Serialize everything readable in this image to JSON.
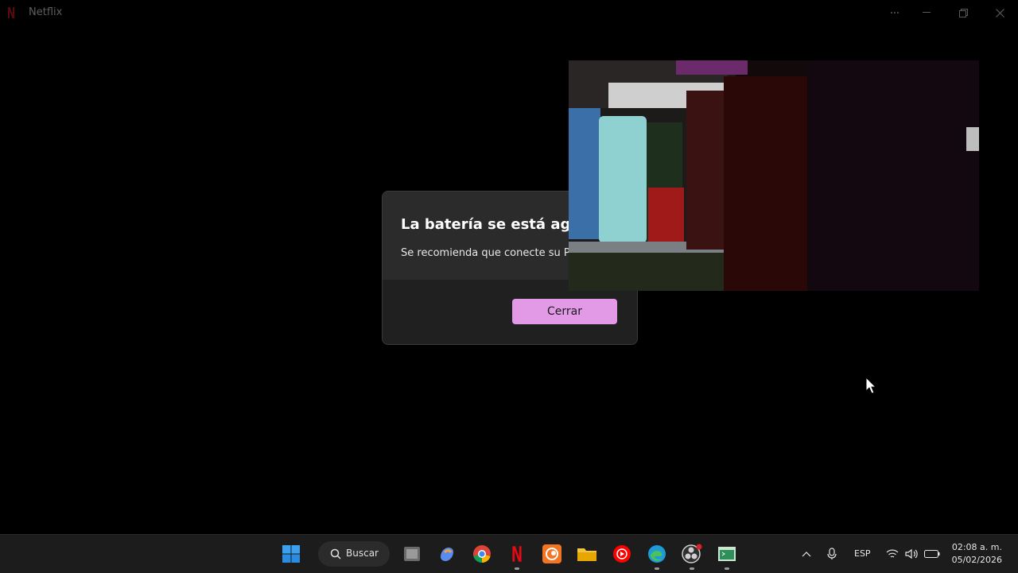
{
  "window": {
    "title": "Netflix",
    "brand_color": "#e50914"
  },
  "dialog": {
    "title": "La batería se está agota",
    "message": "Se recomienda que conecte su PC",
    "close_label": "Cerrar",
    "accent_color": "#e29ae6"
  },
  "taskbar": {
    "search_label": "Buscar",
    "language": "ESP",
    "time": "02:08 a. m.",
    "date": "05/02/2026",
    "apps": [
      "windows-start-icon",
      "task-view-icon",
      "copilot-icon",
      "chrome-icon",
      "netflix-icon",
      "crunchyroll-icon",
      "file-explorer-icon",
      "youtube-music-icon",
      "edge-icon",
      "obs-icon",
      "terminal-icon"
    ]
  }
}
